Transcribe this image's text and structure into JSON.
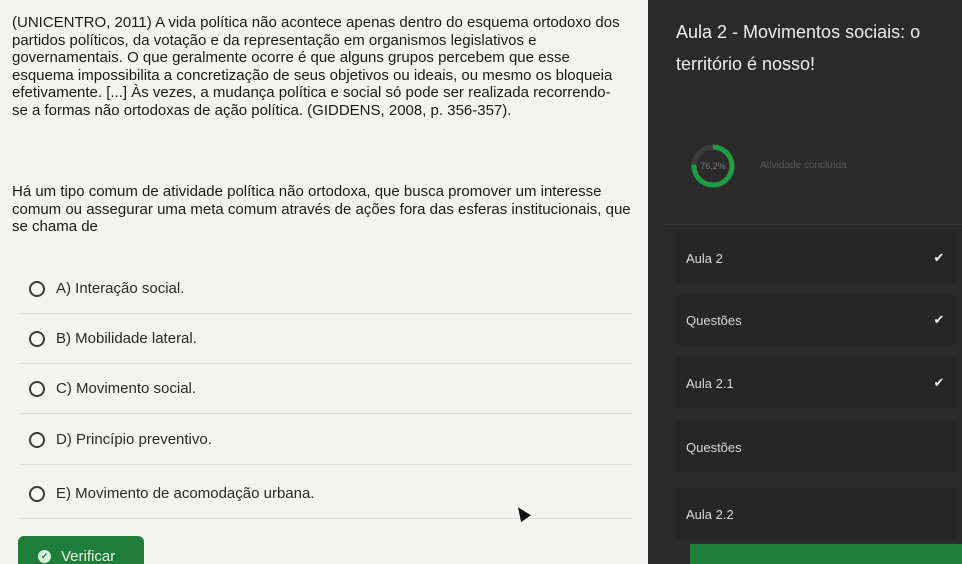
{
  "question": {
    "statement": "(UNICENTRO, 2011) A vida política não acontece apenas dentro do esquema ortodoxo dos partidos políticos, da votação e da representação em organismos legislativos e governamentais. O que geralmente ocorre é que alguns grupos percebem que esse esquema impossibilita a concretização de seus objetivos ou ideais, ou mesmo os bloqueia efetivamente. [...] Às vezes, a mudança política e social só pode ser realizada recorrendo-se a formas não ortodoxas de ação política. (GIDDENS, 2008, p. 356-357).",
    "prompt": "Há um tipo comum de atividade política não ortodoxa, que busca promover um interesse comum ou assegurar uma meta comum através de ações fora das esferas institucionais, que se chama de",
    "options": [
      {
        "label": "A) Interação social."
      },
      {
        "label": "B) Mobilidade lateral."
      },
      {
        "label": "C) Movimento social."
      },
      {
        "label": "D) Princípio preventivo."
      },
      {
        "label": "E) Movimento de acomodação urbana."
      }
    ],
    "verify_label": "Verificar"
  },
  "sidebar": {
    "title": "Aula 2 - Movimentos sociais: o território é nosso!",
    "progress_text": "76,2%",
    "progress_fraction": 0.762,
    "progress_caption": "Atividade concluída",
    "items": [
      {
        "label": "Aula 2",
        "done": true
      },
      {
        "label": "Questões",
        "done": true
      },
      {
        "label": "Aula 2.1",
        "done": true
      },
      {
        "label": "Questões",
        "done": false
      },
      {
        "label": "Aula 2.2",
        "done": false
      }
    ]
  },
  "colors": {
    "accent_green": "#1f7d3a",
    "panel_bg": "#f3f3f1",
    "sidebar_bg": "#2a2a2a"
  }
}
